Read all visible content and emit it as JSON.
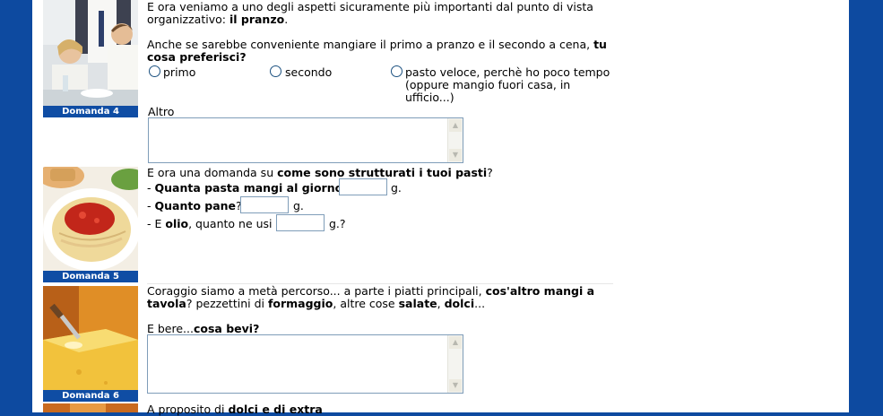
{
  "q4": {
    "caption": "Domanda 4",
    "intro_a": "E ora veniamo a uno degli aspetti sicuramente più importanti dal punto di vista organizzativo: ",
    "intro_b": "il pranzo",
    "intro_c": ".",
    "question_a": "Anche se sarebbe conveniente mangiare il primo a pranzo e il secondo a cena, ",
    "question_b": "tu cosa preferisci?",
    "options": [
      "primo",
      "secondo",
      "pasto veloce, perchè ho poco tempo (oppure mangio fuori casa, in ufficio...)"
    ],
    "other_label": "Altro"
  },
  "q5": {
    "caption": "Domanda 5",
    "intro_a": "E ora una domanda su ",
    "intro_b": "come sono strutturati i tuoi pasti",
    "intro_c": "?",
    "line1_a": "- ",
    "line1_b": "Quanta pasta mangi al giorno",
    "line1_c": "?",
    "line1_unit": "g.",
    "line2_a": "- ",
    "line2_b": "Quanto pane",
    "line2_c": "?",
    "line2_unit": "g.",
    "line3_a": "- E ",
    "line3_b": "olio",
    "line3_c": ", quanto ne usi",
    "line3_unit": "g.?"
  },
  "q6": {
    "caption": "Domanda 6",
    "intro_a": "Coraggio siamo a metà percorso... a parte i piatti principali, ",
    "intro_b": "cos'altro mangi a tavola",
    "intro_c": "? pezzettini di ",
    "intro_d": "formaggio",
    "intro_e": ", altre cose ",
    "intro_f": "salate",
    "intro_g": ", ",
    "intro_h": "dolci",
    "intro_i": "...",
    "drink_a": "E bere...",
    "drink_b": "cosa bevi?"
  },
  "q7": {
    "intro_a": "A proposito di ",
    "intro_b": "dolci e di extra"
  },
  "icons": [
    "scroll-up-arrow-icon",
    "scroll-down-arrow-icon"
  ]
}
